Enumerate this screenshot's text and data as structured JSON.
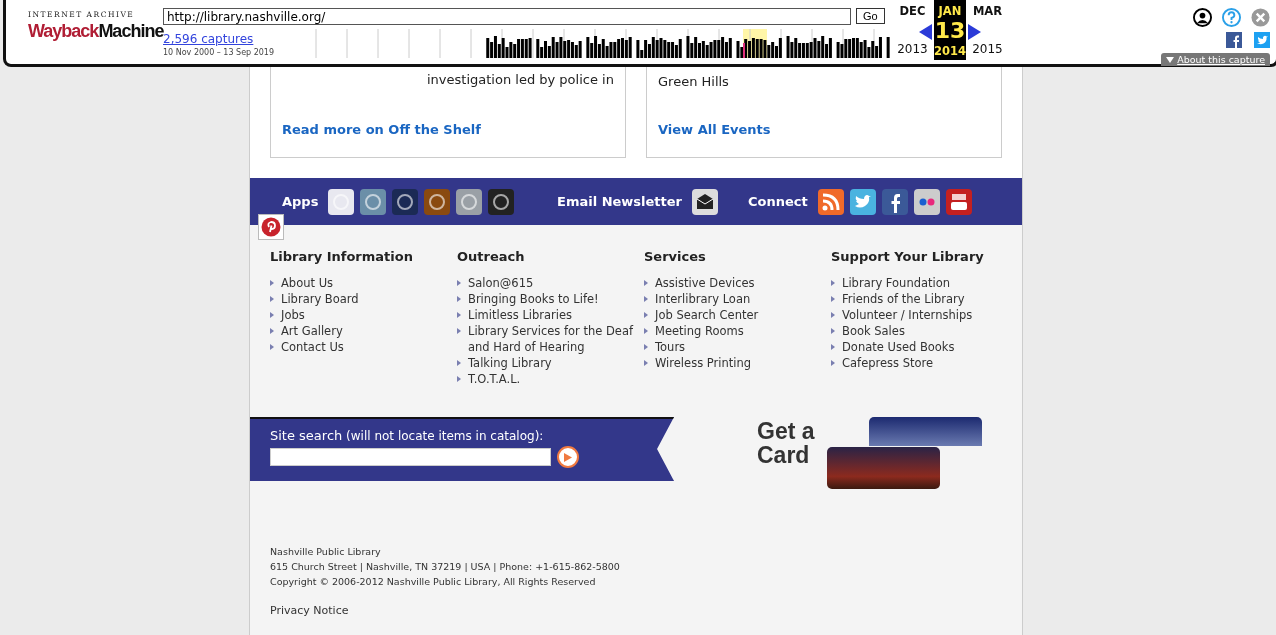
{
  "wayback": {
    "logo_top": "INTERNET ARCHIVE",
    "logo_red": "Wayback",
    "logo_black": "Machine",
    "url": "http://library.nashville.org/",
    "go": "Go",
    "captures": "2,596 captures",
    "date_range": "10 Nov 2000 – 13 Sep 2019",
    "calendar": [
      {
        "month": "DEC",
        "year": "2013",
        "selected": false
      },
      {
        "month": "JAN",
        "day": "13",
        "year": "2014",
        "selected": true
      },
      {
        "month": "MAR",
        "year": "2015",
        "selected": false
      }
    ],
    "about": "About this capture"
  },
  "cards": [
    {
      "lines": [
        "investigation led by police in"
      ],
      "link": "Read more on Off the Shelf"
    },
    {
      "lines": [
        "Green Hills"
      ],
      "link": "View All Events"
    }
  ],
  "band": {
    "apps_label": "Apps",
    "newsletter_label": "Email Newsletter",
    "connect_label": "Connect"
  },
  "columns": [
    {
      "title": "Library Information",
      "items": [
        "About Us",
        "Library Board",
        "Jobs",
        "Art Gallery",
        "Contact Us"
      ]
    },
    {
      "title": "Outreach",
      "items": [
        "Salon@615",
        "Bringing Books to Life!",
        "Limitless Libraries",
        "Library Services for the Deaf and Hard of Hearing",
        "Talking Library",
        "T.O.T.A.L."
      ]
    },
    {
      "title": "Services",
      "items": [
        "Assistive Devices",
        "Interlibrary Loan",
        "Job Search Center",
        "Meeting Rooms",
        "Tours",
        "Wireless Printing"
      ]
    },
    {
      "title": "Support Your Library",
      "items": [
        "Library Foundation",
        "Friends of the Library",
        "Volunteer / Internships",
        "Book Sales",
        "Donate Used Books",
        "Cafepress Store"
      ]
    }
  ],
  "search": {
    "label": "Site search",
    "hint": "(will not locate items in catalog):"
  },
  "get_card": [
    "Get a",
    "Card"
  ],
  "address": [
    "Nashville Public Library",
    "615 Church Street | Nashville, TN 37219 | USA | Phone: +1-615-862-5800",
    "Copyright © 2006-2012 Nashville Public Library, All Rights Reserved"
  ],
  "privacy": "Privacy Notice"
}
